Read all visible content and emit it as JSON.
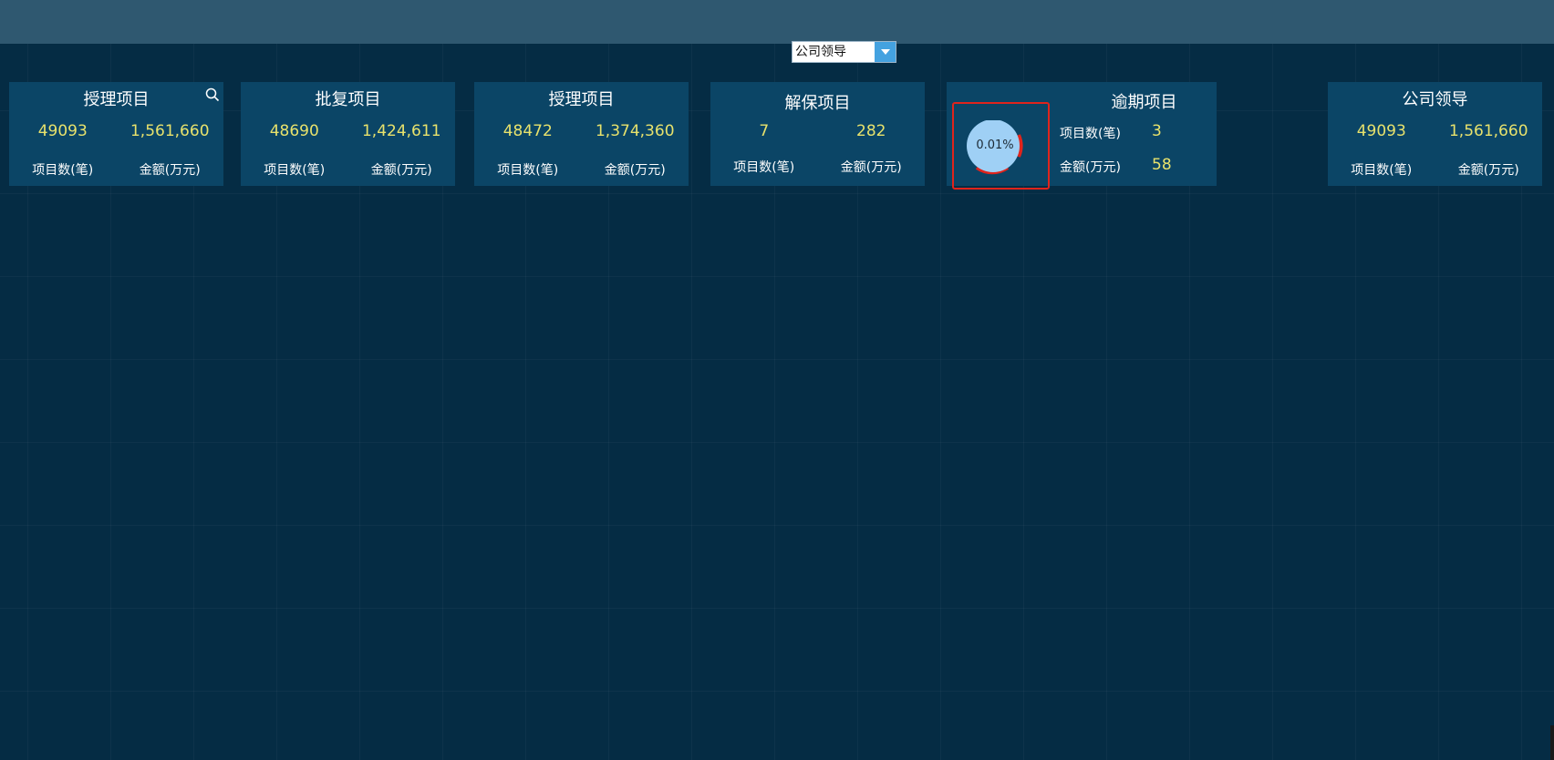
{
  "selector": {
    "value": "公司领导"
  },
  "cards": [
    {
      "title": "授理项目",
      "count": "49093",
      "amount": "1,561,660",
      "count_label": "项目数(笔)",
      "amount_label": "金额(万元)"
    },
    {
      "title": "批复项目",
      "count": "48690",
      "amount": "1,424,611",
      "count_label": "项目数(笔)",
      "amount_label": "金额(万元)"
    },
    {
      "title": "授理项目",
      "count": "48472",
      "amount": "1,374,360",
      "count_label": "项目数(笔)",
      "amount_label": "金额(万元)"
    },
    {
      "title": "解保项目",
      "count": "7",
      "amount": "282",
      "count_label": "项目数(笔)",
      "amount_label": "金额(万元)"
    },
    {
      "title": "公司领导",
      "count": "49093",
      "amount": "1,561,660",
      "count_label": "项目数(笔)",
      "amount_label": "金额(万元)"
    }
  ],
  "overdue": {
    "title": "逾期项目",
    "count_label": "项目数(笔)",
    "count": "3",
    "amount_label": "金额(万元)",
    "amount": "58",
    "gauge_text": "0.01%",
    "gauge_fraction": 0.0001
  },
  "colors": {
    "background": "#052c44",
    "topbar": "#2f5870",
    "card": "#0b4566",
    "value": "#e8e26c",
    "gauge_fill": "#9fd0f5",
    "gauge_alert": "#e0241c"
  },
  "icons": {
    "search": "search-icon",
    "dropdown": "chevron-down-icon"
  }
}
